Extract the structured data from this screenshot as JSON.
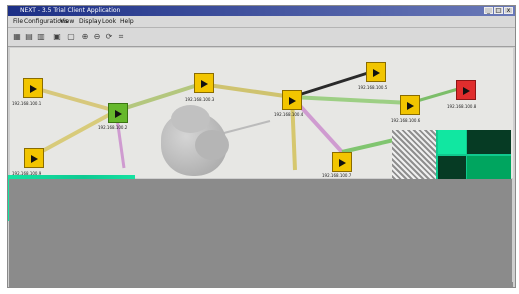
{
  "window": {
    "title": "NEXT - 3.5 Trial Client Application",
    "controls": [
      "_",
      "□",
      "x"
    ]
  },
  "menu": [
    "File",
    "Configurations",
    "View",
    "Display",
    "Look",
    "Help"
  ],
  "toolbar": {
    "icons": [
      "new-icon",
      "open-icon",
      "save-icon",
      "print-icon",
      "copy-icon",
      "zoom-in-icon",
      "zoom-out-icon",
      "refresh-icon",
      "layout-icon"
    ]
  },
  "nodes": [
    {
      "name": "node-1",
      "label": "192.168.100.1",
      "color": "#f2c500"
    },
    {
      "name": "node-2",
      "label": "192.168.100.2",
      "color": "#66b82c"
    },
    {
      "name": "node-3",
      "label": "192.168.100.3",
      "color": "#f2c500"
    },
    {
      "name": "node-4",
      "label": "192.168.100.4",
      "color": "#f2c500"
    },
    {
      "name": "node-5",
      "label": "192.168.100.5",
      "color": "#f2c500"
    },
    {
      "name": "node-6",
      "label": "192.168.100.6",
      "color": "#f2c500"
    },
    {
      "name": "node-7",
      "label": "192.168.100.7",
      "color": "#f2c500"
    },
    {
      "name": "node-8",
      "label": "192.168.100.8",
      "color": "#e02d2d"
    },
    {
      "name": "node-9",
      "label": "192.168.100.9",
      "color": "#f2c500"
    }
  ],
  "links": [
    {
      "from": "node-1",
      "to": "node-2"
    },
    {
      "from": "node-2",
      "to": "node-3"
    },
    {
      "from": "node-3",
      "to": "node-4"
    },
    {
      "from": "node-4",
      "to": "node-5"
    },
    {
      "from": "node-4",
      "to": "node-6"
    },
    {
      "from": "node-6",
      "to": "node-8"
    },
    {
      "from": "node-4",
      "to": "node-7"
    },
    {
      "from": "node-7",
      "to": "node-9"
    }
  ],
  "cloud": {
    "name": "network-cloud"
  }
}
